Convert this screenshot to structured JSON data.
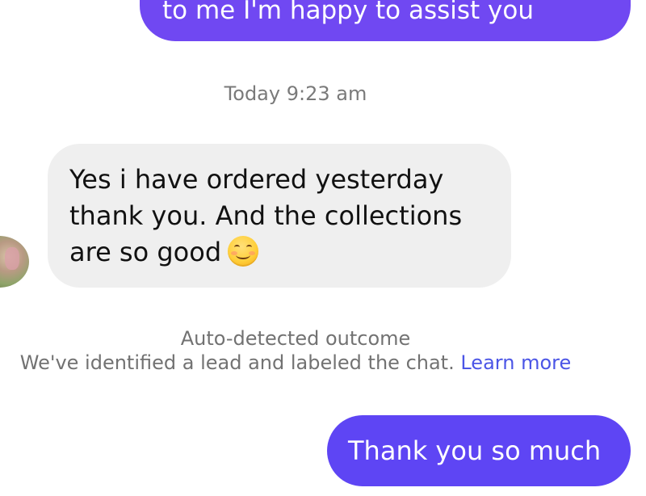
{
  "conversation": {
    "top_message": {
      "text": "to me I'm happy to assist you"
    },
    "timestamp": "Today 9:23 am",
    "incoming_message": {
      "text": "Yes i have ordered yesterday\nthank you. And the collections\nare so good",
      "emoji": "smiling-face-with-smiling-eyes"
    },
    "auto_detected": {
      "title": "Auto-detected outcome",
      "body": "We've identified a lead and labeled the chat.",
      "link_label": "Learn more"
    },
    "outgoing_message": {
      "text": "Thank you so much"
    }
  },
  "colors": {
    "outgoing_bubble": "#6a4cf5",
    "incoming_bubble": "#efefef",
    "link": "#4b55e6",
    "meta_text": "#7a7a7a"
  }
}
